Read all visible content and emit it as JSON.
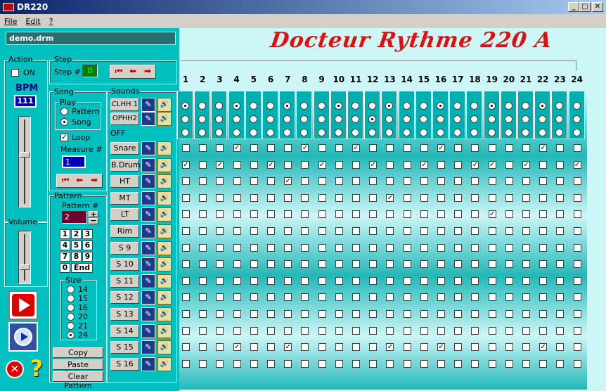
{
  "window": {
    "title": "DR220",
    "min": "_",
    "max": "□",
    "close": "✕"
  },
  "menu": [
    "File",
    "Edit",
    "?"
  ],
  "file_name": "demo.drm",
  "logo": "Docteur Rythme 220 A",
  "action": {
    "legend": "Action",
    "on_label": "ON",
    "on_checked": false,
    "bpm_label": "BPM",
    "bpm_value": "111",
    "tempo_level": 0.6
  },
  "volume": {
    "legend": "Volume",
    "level": 0.3
  },
  "step": {
    "legend": "Step",
    "label": "Step #",
    "value": "0"
  },
  "song": {
    "legend": "Song",
    "play_legend": "Play",
    "pattern_label": "Pattern",
    "song_label": "Song",
    "selected": "Song",
    "loop_label": "Loop",
    "loop_checked": true,
    "measure_label": "Measure #",
    "measure_value": "1"
  },
  "pattern": {
    "legend": "Pattern",
    "number_label": "Pattern #",
    "number_value": "2",
    "plus": "+",
    "minus": "−",
    "keys": [
      "1",
      "2",
      "3",
      "4",
      "5",
      "6",
      "7",
      "8",
      "9",
      "0",
      "End"
    ],
    "size_legend": "Size",
    "sizes": [
      "14",
      "15",
      "16",
      "20",
      "21",
      "24"
    ],
    "size_selected": "24",
    "copy": "Copy pattern",
    "paste": "Paste Pattern",
    "clear": "Clear Pattern"
  },
  "sounds": {
    "legend": "Sounds",
    "off_label": "OFF",
    "hats": [
      "CLHH 1",
      "OPHH2"
    ],
    "instruments": [
      "Snare",
      "B.Drum",
      "HT",
      "MT",
      "LT",
      "Rim",
      "S 9",
      "S 10",
      "S 11",
      "S 12",
      "S 13",
      "S 14",
      "S 15",
      "S 16"
    ]
  },
  "steps": [
    "1",
    "2",
    "3",
    "4",
    "5",
    "6",
    "7",
    "8",
    "9",
    "10",
    "11",
    "12",
    "13",
    "14",
    "15",
    "16",
    "17",
    "18",
    "19",
    "20",
    "21",
    "22",
    "23",
    "24"
  ],
  "hat_rows": [
    [
      1,
      0,
      0,
      1,
      0,
      0,
      1,
      0,
      0,
      1,
      0,
      0,
      1,
      0,
      0,
      1,
      0,
      0,
      1,
      0,
      0,
      1,
      0,
      0
    ],
    [
      0,
      0,
      0,
      0,
      0,
      0,
      0,
      0,
      0,
      0,
      0,
      1,
      0,
      0,
      0,
      0,
      0,
      0,
      0,
      0,
      0,
      0,
      0,
      0
    ],
    [
      0,
      0,
      0,
      0,
      0,
      0,
      0,
      0,
      0,
      0,
      0,
      0,
      0,
      0,
      0,
      0,
      0,
      0,
      0,
      0,
      0,
      0,
      0,
      0
    ]
  ],
  "grid": [
    [
      0,
      0,
      0,
      1,
      0,
      0,
      0,
      1,
      0,
      0,
      1,
      0,
      0,
      0,
      0,
      1,
      0,
      0,
      0,
      0,
      0,
      1,
      0,
      0
    ],
    [
      1,
      0,
      1,
      0,
      0,
      1,
      0,
      0,
      1,
      0,
      0,
      1,
      0,
      0,
      1,
      0,
      0,
      1,
      1,
      0,
      1,
      0,
      0,
      1
    ],
    [
      0,
      0,
      0,
      0,
      0,
      0,
      1,
      0,
      0,
      0,
      0,
      0,
      0,
      0,
      0,
      0,
      0,
      0,
      0,
      0,
      0,
      0,
      0,
      0
    ],
    [
      0,
      0,
      0,
      0,
      0,
      0,
      0,
      0,
      0,
      0,
      0,
      0,
      1,
      0,
      0,
      0,
      0,
      0,
      0,
      0,
      0,
      0,
      0,
      0
    ],
    [
      0,
      0,
      0,
      0,
      0,
      0,
      0,
      0,
      0,
      0,
      0,
      0,
      0,
      0,
      0,
      0,
      0,
      0,
      1,
      0,
      0,
      0,
      0,
      0
    ],
    [
      0,
      0,
      0,
      0,
      0,
      0,
      0,
      0,
      0,
      0,
      0,
      0,
      0,
      0,
      0,
      0,
      0,
      0,
      0,
      0,
      0,
      0,
      0,
      0
    ],
    [
      0,
      0,
      0,
      0,
      0,
      0,
      0,
      0,
      0,
      0,
      0,
      0,
      0,
      0,
      0,
      0,
      0,
      0,
      0,
      0,
      0,
      0,
      0,
      0
    ],
    [
      0,
      0,
      0,
      0,
      0,
      0,
      0,
      0,
      0,
      0,
      0,
      0,
      0,
      0,
      0,
      0,
      0,
      0,
      0,
      0,
      0,
      0,
      0,
      0
    ],
    [
      0,
      0,
      0,
      0,
      0,
      0,
      0,
      0,
      0,
      0,
      0,
      0,
      0,
      0,
      0,
      0,
      0,
      0,
      0,
      0,
      0,
      0,
      0,
      0
    ],
    [
      0,
      0,
      0,
      0,
      0,
      0,
      0,
      0,
      0,
      0,
      0,
      0,
      0,
      0,
      0,
      0,
      0,
      0,
      0,
      0,
      0,
      0,
      0,
      0
    ],
    [
      0,
      0,
      0,
      0,
      0,
      0,
      0,
      0,
      0,
      0,
      0,
      0,
      0,
      0,
      0,
      0,
      0,
      0,
      0,
      0,
      0,
      0,
      0,
      0
    ],
    [
      0,
      0,
      0,
      0,
      0,
      0,
      0,
      0,
      0,
      0,
      0,
      0,
      0,
      0,
      0,
      0,
      0,
      0,
      0,
      0,
      0,
      0,
      0,
      0
    ],
    [
      0,
      0,
      0,
      1,
      0,
      0,
      1,
      0,
      0,
      0,
      0,
      0,
      1,
      0,
      0,
      1,
      0,
      0,
      0,
      0,
      0,
      1,
      0,
      0
    ],
    [
      0,
      0,
      0,
      0,
      0,
      0,
      0,
      0,
      0,
      0,
      0,
      0,
      0,
      0,
      0,
      0,
      0,
      0,
      0,
      0,
      0,
      0,
      0,
      0
    ]
  ],
  "colors": {
    "teal": "#00c0c0",
    "logo_red": "#e01010",
    "bpm_bg": "#0000c0"
  }
}
